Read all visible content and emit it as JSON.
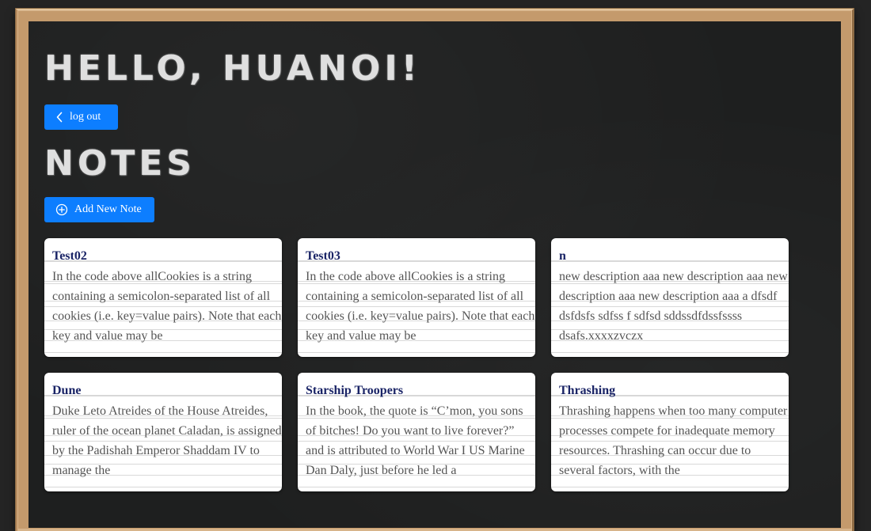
{
  "header": {
    "greeting": "Hello, Huanoi!",
    "logout_label": "log out",
    "notes_title": "Notes",
    "add_note_label": "Add New Note"
  },
  "notes": [
    {
      "title": "Test02",
      "description": "In the code above allCookies is a string containing a semicolon-separated list of all cookies (i.e. key=value pairs). Note that each key and value may be"
    },
    {
      "title": "Test03",
      "description": "In the code above allCookies is a string containing a semicolon-separated list of all cookies (i.e. key=value pairs). Note that each key and value may be"
    },
    {
      "title": "n",
      "description": "new description aaa new description aaa new description aaa new description aaa a dfsdf dsfdsfs sdfss f sdfsd sddssdfdssfssss dsafs.xxxxzvczx"
    },
    {
      "title": "Dune",
      "description": "Duke Leto Atreides of the House Atreides, ruler of the ocean planet Caladan, is assigned by the Padishah Emperor Shaddam IV to manage the"
    },
    {
      "title": "Starship Troopers",
      "description": "In the book, the quote is “C’mon, you sons of bitches! Do you want to live forever?” and is attributed to World War I US Marine Dan Daly, just before he led a"
    },
    {
      "title": "Thrashing",
      "description": "Thrashing happens when too many computer processes compete for inadequate memory resources. Thrashing can occur due to several factors, with the"
    }
  ],
  "icons": {
    "logout": "chevron-left-icon",
    "add": "plus-circle-icon"
  },
  "colors": {
    "accent": "#0d7eff",
    "board": "#1e1f1f",
    "frame": "#c49a6c",
    "note_title": "#1a2466",
    "note_text": "#555555"
  }
}
